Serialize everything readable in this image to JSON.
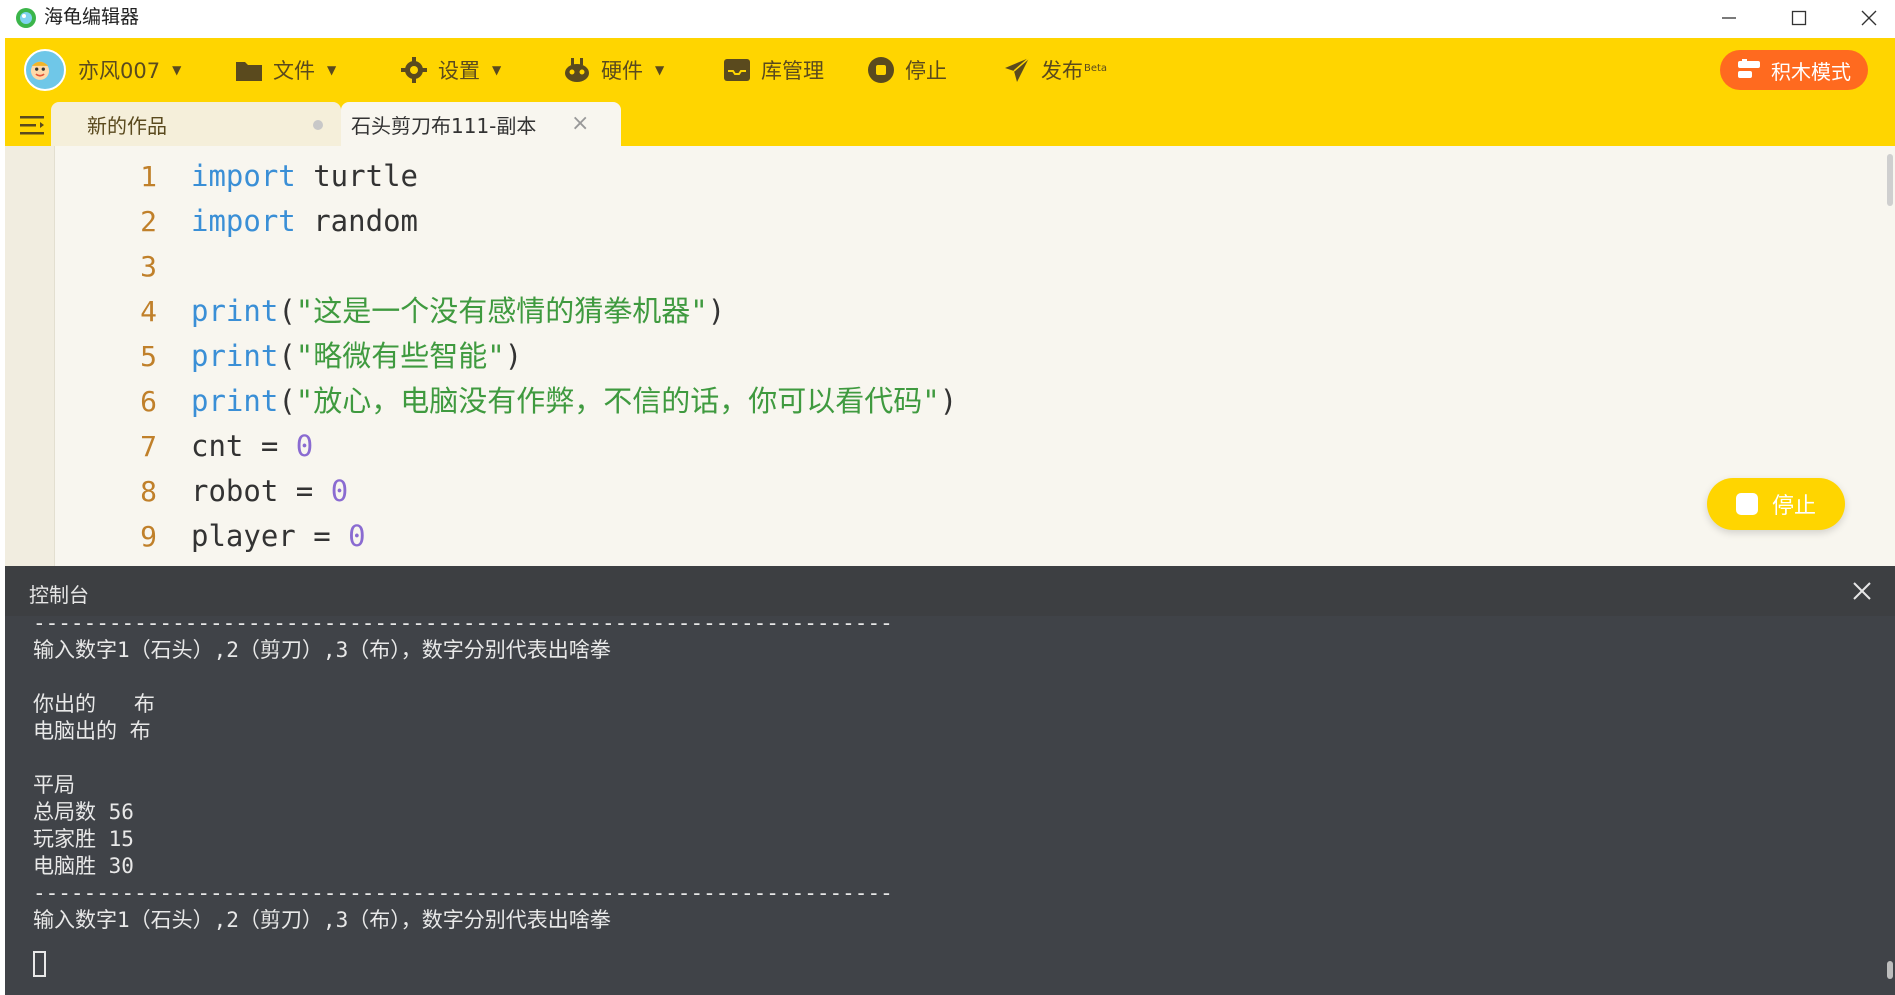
{
  "window": {
    "title": "海龟编辑器",
    "minimize_icon": "minimize-icon",
    "maximize_icon": "maximize-icon",
    "close_icon": "close-icon"
  },
  "toolbar": {
    "username": "亦风007",
    "file": "文件",
    "settings": "设置",
    "hardware": "硬件",
    "library": "库管理",
    "stop": "停止",
    "publish": "发布",
    "publish_badge": "Beta",
    "blocks_mode": "积木模式",
    "accent_color": "#ffd500",
    "blocks_button_color": "#ff6a1f"
  },
  "tabs": [
    {
      "label": "新的作品",
      "active": false,
      "unsaved": true
    },
    {
      "label": "石头剪刀布111-副本",
      "active": true
    }
  ],
  "editor": {
    "lines": [
      {
        "number": "1",
        "segments": [
          [
            "kw",
            "import"
          ],
          [
            "txt",
            " turtle"
          ]
        ]
      },
      {
        "number": "2",
        "segments": [
          [
            "kw",
            "import"
          ],
          [
            "txt",
            " random"
          ]
        ]
      },
      {
        "number": "3",
        "segments": []
      },
      {
        "number": "4",
        "segments": [
          [
            "kw",
            "print"
          ],
          [
            "txt",
            "("
          ],
          [
            "str",
            "\"这是一个没有感情的猜拳机器\""
          ],
          [
            "txt",
            ")"
          ]
        ]
      },
      {
        "number": "5",
        "segments": [
          [
            "kw",
            "print"
          ],
          [
            "txt",
            "("
          ],
          [
            "str",
            "\"略微有些智能\""
          ],
          [
            "txt",
            ")"
          ]
        ]
      },
      {
        "number": "6",
        "segments": [
          [
            "kw",
            "print"
          ],
          [
            "txt",
            "("
          ],
          [
            "str",
            "\"放心，电脑没有作弊，不信的话，你可以看代码\""
          ],
          [
            "txt",
            ")"
          ]
        ]
      },
      {
        "number": "7",
        "segments": [
          [
            "txt",
            "cnt = "
          ],
          [
            "num",
            "0"
          ]
        ]
      },
      {
        "number": "8",
        "segments": [
          [
            "txt",
            "robot = "
          ],
          [
            "num",
            "0"
          ]
        ]
      },
      {
        "number": "9",
        "segments": [
          [
            "txt",
            "player = "
          ],
          [
            "num",
            "0"
          ]
        ]
      }
    ],
    "stop_button": "停止"
  },
  "console": {
    "title": "控制台",
    "lines": [
      "--------------------------------------------------------------------",
      "输入数字1（石头）,2（剪刀）,3（布），数字分别代表出啥拳",
      "",
      "你出的   布",
      "电脑出的 布",
      "",
      "平局",
      "总局数 56",
      "玩家胜 15",
      "电脑胜 30",
      "--------------------------------------------------------------------",
      "输入数字1（石头）,2（剪刀）,3（布），数字分别代表出啥拳"
    ]
  }
}
